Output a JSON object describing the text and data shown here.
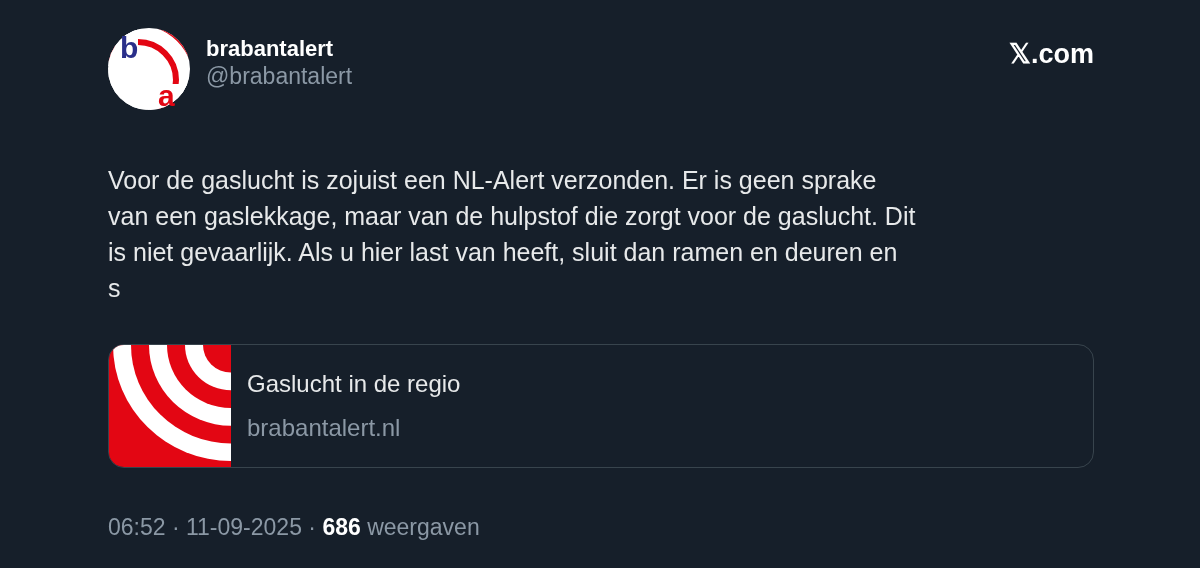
{
  "author": {
    "avatar_letters": [
      "b",
      "a"
    ],
    "name": "brabantalert",
    "handle": "@brabantalert"
  },
  "source": "𝕏.com",
  "body_lines": [
    "Voor de gaslucht is zojuist een NL-Alert verzonden. Er is geen sprake",
    "van een gaslekkage, maar van de hulpstof die zorgt voor de gaslucht. Dit",
    "is niet gevaarlijk. Als u hier last van heeft, sluit dan ramen en deuren en",
    "s"
  ],
  "link_card": {
    "title": "Gaslucht in de regio",
    "domain": "brabantalert.nl"
  },
  "footer": "06:52 · 11-09-2025 · **686** weergaven"
}
